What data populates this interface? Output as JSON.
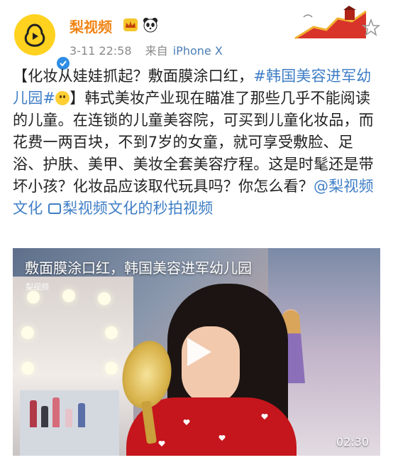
{
  "user": {
    "name": "梨视频",
    "timestamp": "3-11 22:58",
    "source_prefix": "来自",
    "source": "iPhone X"
  },
  "post": {
    "text_1": "【化妆从娃娃抓起？敷面膜涂口红，",
    "hashtag": "#韩国美容进军幼儿园#",
    "text_2": "】韩式美妆产业现在瞄准了那些几乎不能阅读的儿童。在连锁的儿童美容院，可买到儿童化妆品，而花费一两百块，不到7岁的女童，就可享受敷脸、足浴、护肤、美甲、美妆全套美容疗程。这是时髦还是带坏小孩？化妆品应该取代玩具吗？你怎么看？",
    "mention": "@梨视频文化",
    "video_link": "梨视频文化的秒拍视频"
  },
  "video": {
    "title": "敷面膜涂口红，韩国美容进军幼儿园",
    "watermark": "梨视频",
    "duration": "02:30"
  },
  "icons": {
    "avatar": "pear-logo-icon",
    "verified": "verified-check-icon",
    "vip_badge": "crown-badge-icon",
    "panda_badge": "panda-icon",
    "favorite": "star-outline-icon",
    "video_link": "video-link-icon",
    "play": "play-icon"
  },
  "colors": {
    "username": "#f08313",
    "link": "#3f7ec6",
    "meta": "#8a8a8a",
    "verified": "#2f8de4"
  }
}
